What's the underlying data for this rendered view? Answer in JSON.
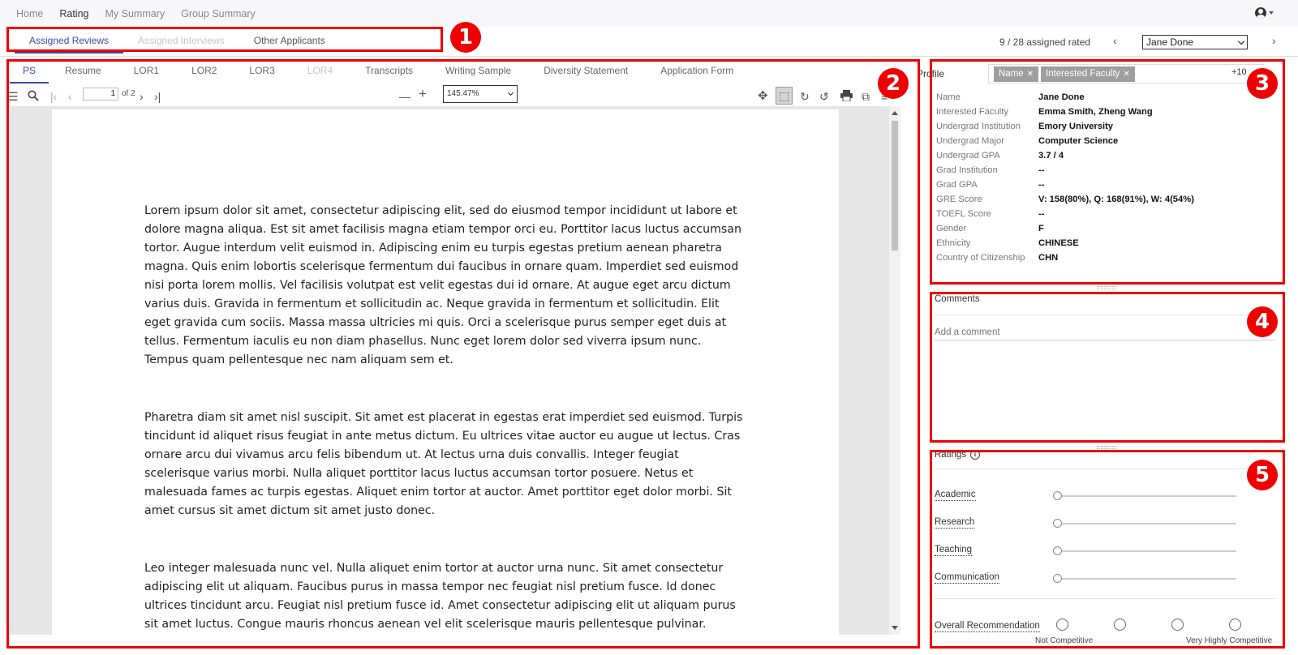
{
  "nav": {
    "links": [
      "Home",
      "Rating",
      "My Summary",
      "Group Summary"
    ],
    "active": "Rating"
  },
  "review_tabs": [
    {
      "label": "Assigned Reviews",
      "state": "active"
    },
    {
      "label": "Assigned Interviews",
      "state": "disabled"
    },
    {
      "label": "Other Applicants",
      "state": "normal"
    }
  ],
  "rated_info": "9 / 28 assigned rated",
  "applicant_select": "Jane Done",
  "doc_tabs": [
    {
      "label": "PS",
      "state": "active"
    },
    {
      "label": "Resume",
      "state": "normal"
    },
    {
      "label": "LOR1",
      "state": "normal"
    },
    {
      "label": "LOR2",
      "state": "normal"
    },
    {
      "label": "LOR3",
      "state": "normal"
    },
    {
      "label": "LOR4",
      "state": "disabled"
    },
    {
      "label": "Transcripts",
      "state": "normal"
    },
    {
      "label": "Writing Sample",
      "state": "normal"
    },
    {
      "label": "Diversity Statement",
      "state": "normal"
    },
    {
      "label": "Application Form",
      "state": "normal"
    }
  ],
  "pdf_toolbar": {
    "page_value": "1",
    "page_of": "of 2",
    "zoom": "145.47%"
  },
  "document": {
    "paragraphs": [
      "Lorem ipsum dolor sit amet, consectetur adipiscing elit, sed do eiusmod tempor incididunt ut labore et dolore magna aliqua. Est sit amet facilisis magna etiam tempor orci eu. Porttitor lacus luctus accumsan tortor. Augue interdum velit euismod in. Adipiscing enim eu turpis egestas pretium aenean pharetra magna. Quis enim lobortis scelerisque fermentum dui faucibus in ornare quam. Imperdiet sed euismod nisi porta lorem mollis. Vel facilisis volutpat est velit egestas dui id ornare. At augue eget arcu dictum varius duis. Gravida in fermentum et sollicitudin ac. Neque gravida in fermentum et sollicitudin. Elit eget gravida cum sociis. Massa massa ultricies mi quis. Orci a scelerisque purus semper eget duis at tellus. Fermentum iaculis eu non diam phasellus. Nunc eget lorem dolor sed viverra ipsum nunc. Tempus quam pellentesque nec nam aliquam sem et.",
      "Pharetra diam sit amet nisl suscipit. Sit amet est placerat in egestas erat imperdiet sed euismod. Turpis tincidunt id aliquet risus feugiat in ante metus dictum. Eu ultrices vitae auctor eu augue ut lectus. Cras ornare arcu dui vivamus arcu felis bibendum ut. At lectus urna duis convallis. Integer feugiat scelerisque varius morbi. Nulla aliquet porttitor lacus luctus accumsan tortor posuere. Netus et malesuada fames ac turpis egestas. Aliquet enim tortor at auctor. Amet porttitor eget dolor morbi. Sit amet cursus sit amet dictum sit amet justo donec.",
      "Leo integer malesuada nunc vel. Nulla aliquet enim tortor at auctor urna nunc. Sit amet consectetur adipiscing elit ut aliquam. Faucibus purus in massa tempor nec feugiat nisl pretium fusce. Id donec ultrices tincidunt arcu. Feugiat nisl pretium fusce id. Amet consectetur adipiscing elit ut aliquam purus sit amet luctus. Congue mauris rhoncus aenean vel elit scelerisque mauris pellentesque pulvinar. Ornare"
    ]
  },
  "profile": {
    "tab_label": "Profile",
    "tags": [
      "Name",
      "Interested Faculty"
    ],
    "more_tags": "+10",
    "rows": [
      {
        "key": "Name",
        "value": "Jane Done"
      },
      {
        "key": "Interested Faculty",
        "value": "Emma Smith, Zheng Wang"
      },
      {
        "key": "Undergrad Institution",
        "value": "Emory University"
      },
      {
        "key": "Undergrad Major",
        "value": "Computer Science"
      },
      {
        "key": "Undergrad GPA",
        "value": "3.7 / 4"
      },
      {
        "key": "Grad Institution",
        "value": "--"
      },
      {
        "key": "Grad GPA",
        "value": "--"
      },
      {
        "key": "GRE Score",
        "value": "V: 158(80%), Q: 168(91%), W: 4(54%)"
      },
      {
        "key": "TOEFL Score",
        "value": "--"
      },
      {
        "key": "Gender",
        "value": "F"
      },
      {
        "key": "Ethnicity",
        "value": "CHINESE"
      },
      {
        "key": "Country of Citizenship",
        "value": "CHN"
      }
    ]
  },
  "comments": {
    "title": "Comments",
    "placeholder": "Add a comment"
  },
  "ratings": {
    "title": "Ratings",
    "criteria": [
      {
        "label": "Academic",
        "value": 0
      },
      {
        "label": "Research",
        "value": 0
      },
      {
        "label": "Teaching",
        "value": 0
      },
      {
        "label": "Communication",
        "value": 0
      }
    ],
    "overall_label": "Overall Recommendation",
    "scale_low": "Not Competitive",
    "scale_high": "Very Highly Competitive"
  },
  "callouts": [
    "1",
    "2",
    "3",
    "4",
    "5"
  ],
  "colors": {
    "accent": "#3949ab",
    "highlight": "#ee0000",
    "tag_bg": "#9e9e9e"
  }
}
